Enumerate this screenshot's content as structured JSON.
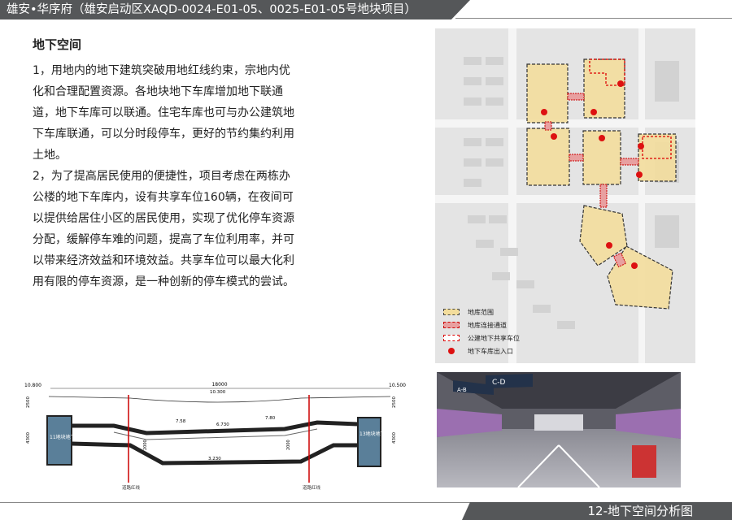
{
  "header": {
    "title": "雄安•华序府（雄安启动区XAQD-0024-E01-05、0025-E01-05号地块项目）"
  },
  "section_heading": "地下空间",
  "paragraphs": [
    "1，用地内的地下建筑突破用地红线约束，宗地内优化和合理配置资源。各地块地下车库增加地下联通道，地下车库可以联通。住宅车库也可与办公建筑地下车库联通，可以分时段停车，更好的节约集约利用土地。",
    "2，为了提高居民使用的便捷性，项目考虑在两栋办公楼的地下车库内，设有共享车位160辆，在夜间可以提供给居住小区的居民使用，实现了优化停车资源分配，缓解停车难的问题，提高了车位利用率，并可以带来经济效益和环境效益。共享车位可以最大化利用有限的停车资源，是一种创新的停车模式的尝试。"
  ],
  "legend": {
    "items": [
      {
        "label": "地库范围"
      },
      {
        "label": "地库连接通道"
      },
      {
        "label": "公建地下共享车位"
      },
      {
        "label": "地下车库出入口"
      }
    ]
  },
  "section_drawing": {
    "total_width": "18000",
    "left_elev": "10.800",
    "right_elev": "10.500",
    "mid_elev": "10.300",
    "left_box": "11地块地下车库",
    "right_box": "13地块地下车库",
    "left_dim_top": "2500",
    "left_dim_bottom": "4300",
    "right_dim_top": "2500",
    "right_dim_bottom": "4300",
    "mid_dim_a": "7.58",
    "mid_dim_b": "6.730",
    "mid_dim_c": "7.80",
    "bottom_dim": "3.230",
    "red_line_left": "道路红线",
    "red_line_right": "道路红线",
    "small_a": "2000",
    "small_b": "2000"
  },
  "photo": {
    "sign_left": "A-B",
    "sign_right": "C-D"
  },
  "footer": {
    "title": "12-地下空间分析图"
  },
  "colors": {
    "bar": "#555759",
    "area_fill": "#f3dd9c",
    "marker": "#d11"
  }
}
